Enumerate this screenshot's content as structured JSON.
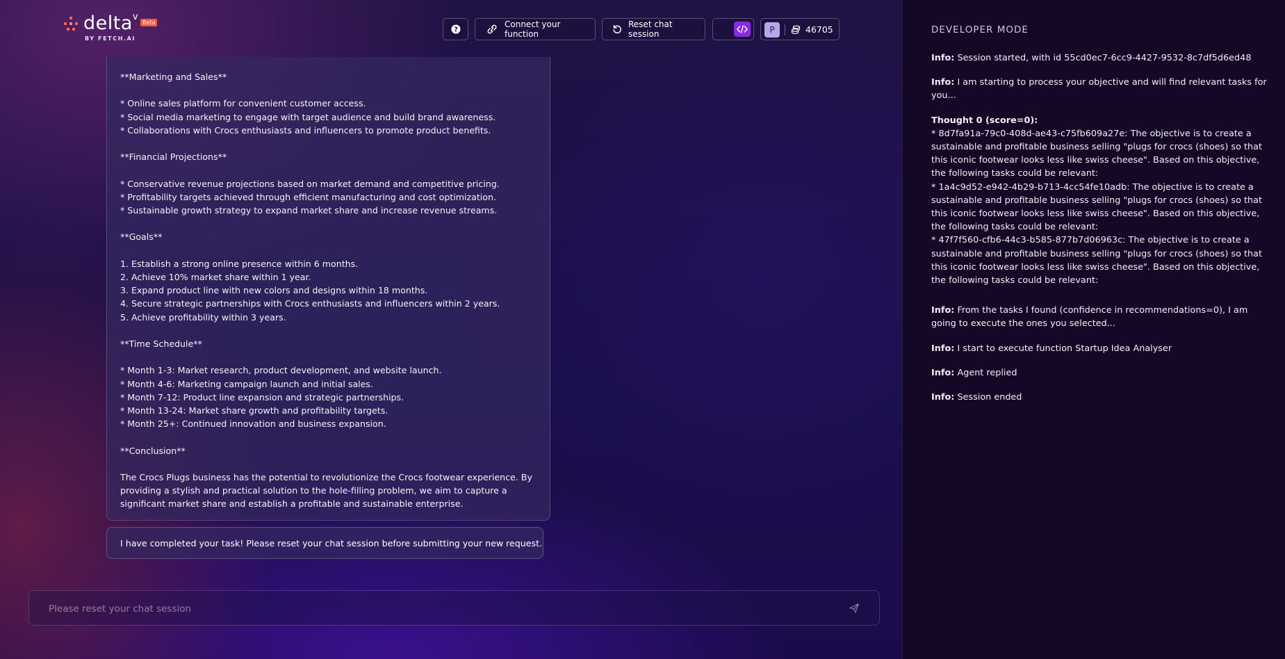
{
  "app": {
    "logo_word": "delta",
    "logo_mark": "v",
    "beta_badge": "Beta",
    "byline": "BY FETCH.AI"
  },
  "header": {
    "help_label": "?",
    "connect_label": "Connect your function",
    "reset_label": "Reset chat session",
    "avatar_initial": "P",
    "credits": "46705",
    "accent_color": "#8a2be2"
  },
  "chat": {
    "response_lines": [
      "**Marketing and Sales**",
      "",
      "* Online sales platform for convenient customer access.",
      "* Social media marketing to engage with target audience and build brand awareness.",
      "* Collaborations with Crocs enthusiasts and influencers to promote product benefits.",
      "",
      "**Financial Projections**",
      "",
      "* Conservative revenue projections based on market demand and competitive pricing.",
      "* Profitability targets achieved through efficient manufacturing and cost optimization.",
      "* Sustainable growth strategy to expand market share and increase revenue streams.",
      "",
      "**Goals**",
      "",
      "1. Establish a strong online presence within 6 months.",
      "2. Achieve 10% market share within 1 year.",
      "3. Expand product line with new colors and designs within 18 months.",
      "4. Secure strategic partnerships with Crocs enthusiasts and influencers within 2 years.",
      "5. Achieve profitability within 3 years.",
      "",
      "**Time Schedule**",
      "",
      "* Month 1-3: Market research, product development, and website launch.",
      "* Month 4-6: Marketing campaign launch and initial sales.",
      "* Month 7-12: Product line expansion and strategic partnerships.",
      "* Month 13-24: Market share growth and profitability targets.",
      "* Month 25+: Continued innovation and business expansion.",
      "",
      "**Conclusion**",
      ""
    ],
    "conclusion": "The Crocs Plugs business has the potential to revolutionize the Crocs footwear experience. By providing a stylish and practical solution to the hole-filling problem, we aim to capture a significant market share and establish a profitable and sustainable enterprise.",
    "completion_message": "I have completed your task! Please reset your chat session before submitting your new request.",
    "input_placeholder": "Please reset your chat session"
  },
  "developer": {
    "title": "DEVELOPER MODE",
    "info_label": "Info:",
    "entries": [
      "Session started, with id 55cd0ec7-6cc9-4427-9532-8c7df5d6ed48",
      "I am starting to process your objective and will find relevant tasks for you..."
    ],
    "thought_heading": "Thought 0 (score=0):",
    "thought_items": [
      "* 8d7fa91a-79c0-408d-ae43-c75fb609a27e: The objective is to create a sustainable and profitable business selling \"plugs for crocs (shoes) so that this iconic footwear looks less like swiss cheese\". Based on this objective, the following tasks could be relevant:",
      "* 1a4c9d52-e942-4b29-b713-4cc54fe10adb: The objective is to create a sustainable and profitable business selling \"plugs for crocs (shoes) so that this iconic footwear looks less like swiss cheese\". Based on this objective, the following tasks could be relevant:",
      "* 47f7f560-cfb6-44c3-b585-877b7d06963c: The objective is to create a sustainable and profitable business selling \"plugs for crocs (shoes) so that this iconic footwear looks less like swiss cheese\". Based on this objective, the following tasks could be relevant:"
    ],
    "later_entries": [
      "From the tasks I found (confidence in recommendations=0), I am going to execute the ones you selected...",
      "I start to execute function Startup Idea Analyser",
      "Agent replied",
      "Session ended"
    ]
  }
}
